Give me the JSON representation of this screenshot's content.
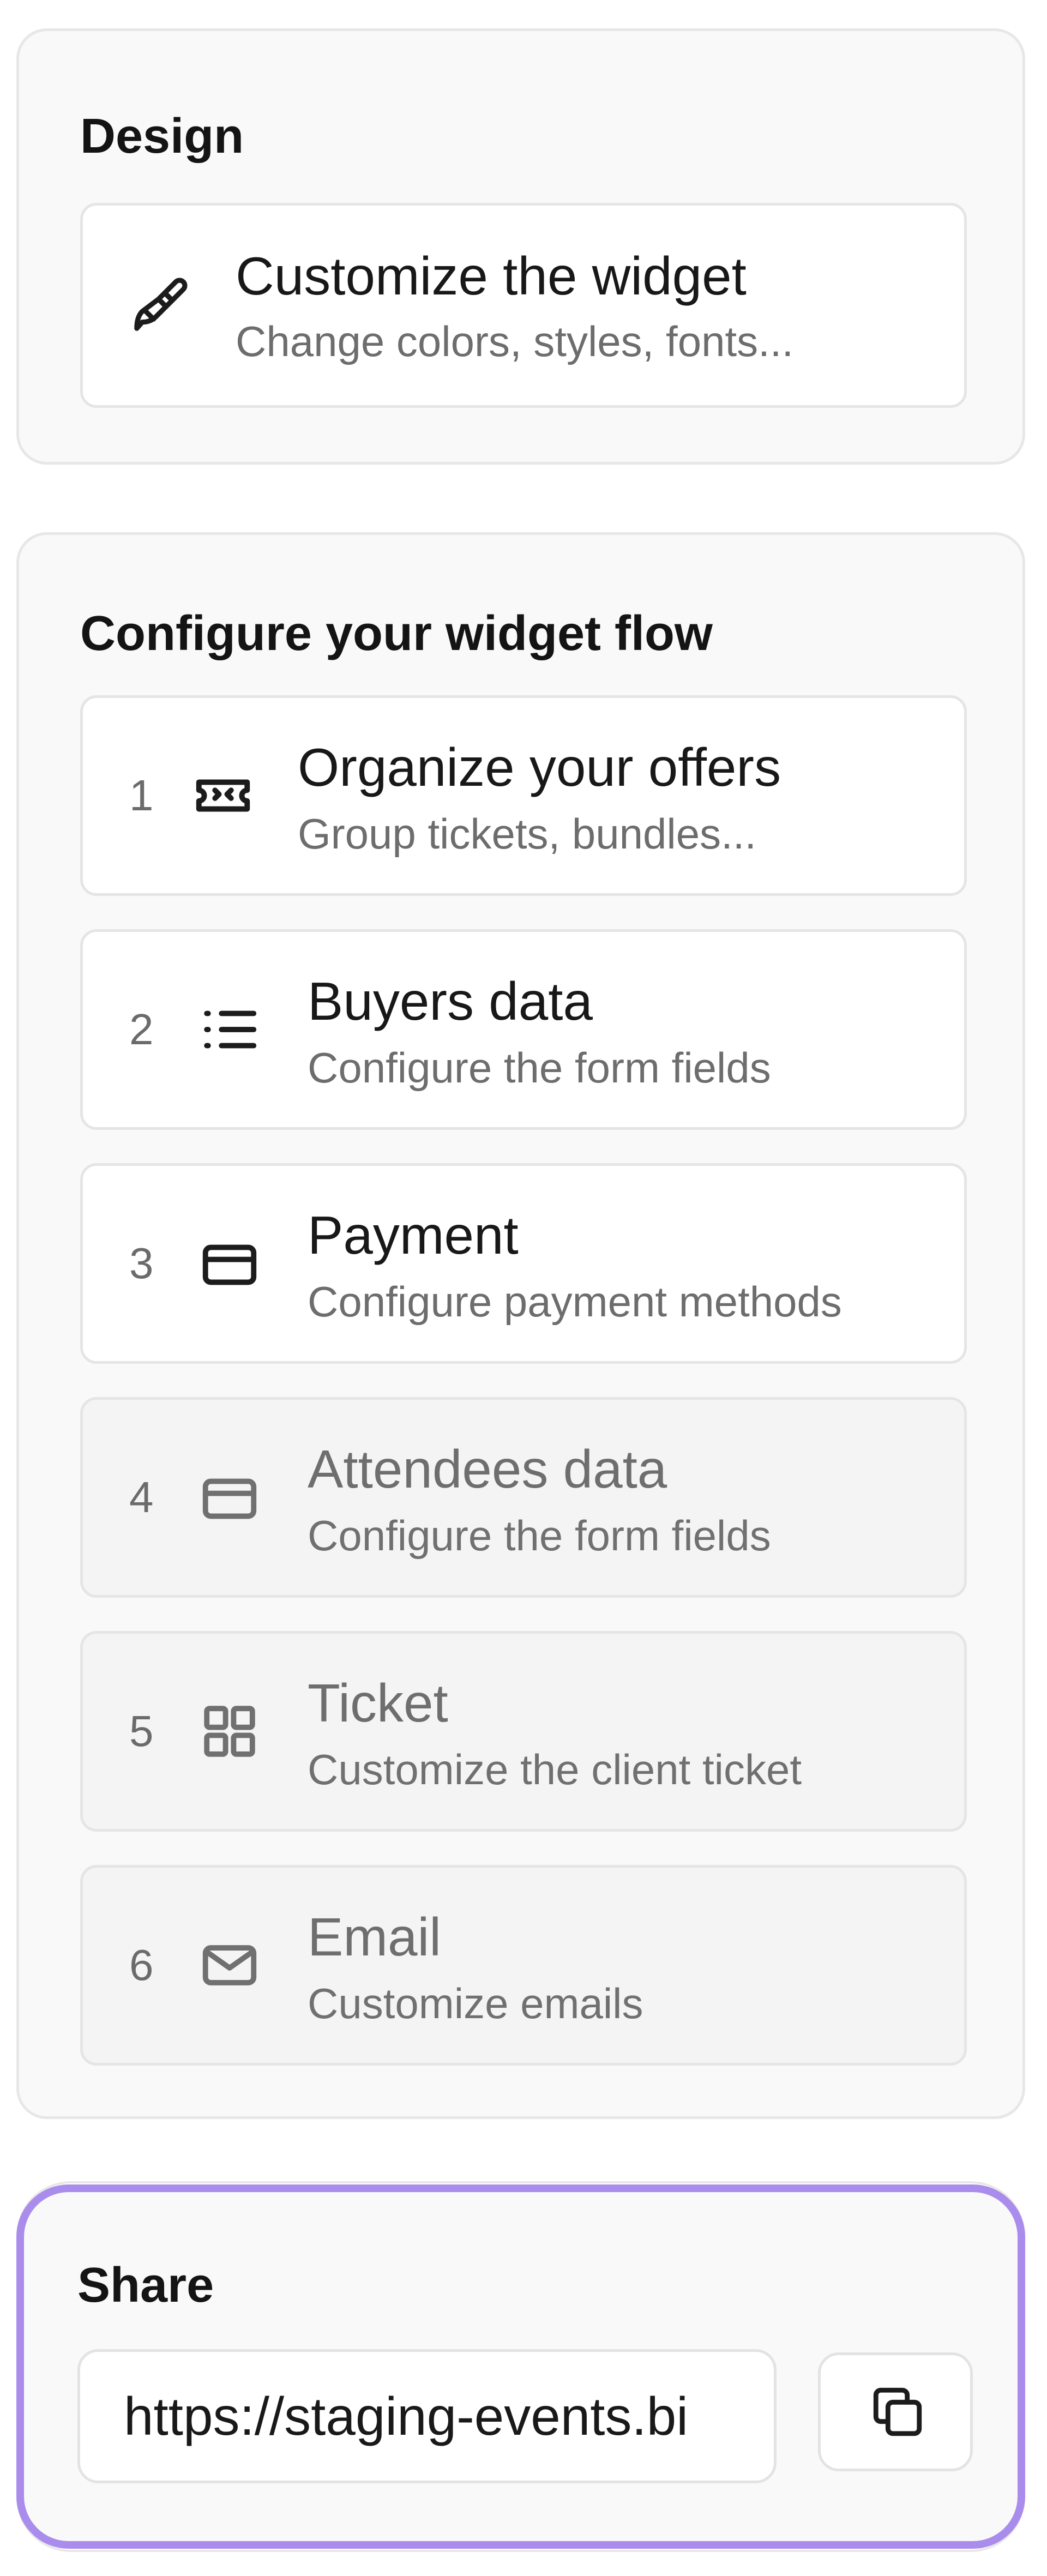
{
  "design": {
    "title": "Design",
    "card": {
      "title": "Customize the widget",
      "subtitle": "Change colors, styles, fonts..."
    }
  },
  "flow": {
    "title": "Configure your widget flow",
    "steps": [
      {
        "number": "1",
        "icon": "ticket-icon",
        "title": "Organize your offers",
        "subtitle": "Group tickets, bundles...",
        "enabled": true
      },
      {
        "number": "2",
        "icon": "list-icon",
        "title": "Buyers data",
        "subtitle": "Configure the form fields",
        "enabled": true
      },
      {
        "number": "3",
        "icon": "credit-card-icon",
        "title": "Payment",
        "subtitle": "Configure payment methods",
        "enabled": true
      },
      {
        "number": "4",
        "icon": "credit-card-icon",
        "title": "Attendees data",
        "subtitle": "Configure the form fields",
        "enabled": false
      },
      {
        "number": "5",
        "icon": "grid-icon",
        "title": "Ticket",
        "subtitle": "Customize the client ticket",
        "enabled": false
      },
      {
        "number": "6",
        "icon": "mail-icon",
        "title": "Email",
        "subtitle": "Customize emails",
        "enabled": false
      }
    ]
  },
  "share": {
    "title": "Share",
    "url": "https://staging-events.bi",
    "copy_icon": "copy-icon",
    "accent_color": "#a98ceb"
  }
}
